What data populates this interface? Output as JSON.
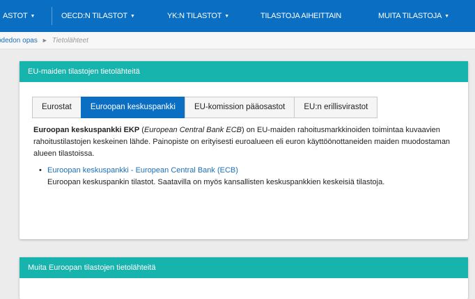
{
  "nav": {
    "items": [
      {
        "label": "ASTOT",
        "has_caret": true
      },
      {
        "label": "OECD:N TILASTOT",
        "has_caret": true
      },
      {
        "label": "YK:N TILASTOT",
        "has_caret": true
      },
      {
        "label": "TILASTOJA AIHEITTAIN",
        "has_caret": false
      },
      {
        "label": "MUITA TILASTOJA",
        "has_caret": true
      }
    ],
    "caret_char": "▼"
  },
  "breadcrumb": {
    "link": "ödedon opas",
    "separator": "►",
    "current": "Tietolähteet"
  },
  "panel1": {
    "title": "EU-maiden tilastojen tietolähteitä",
    "tabs": [
      "Eurostat",
      "Euroopan keskuspankki",
      "EU-komission pääosastot",
      "EU:n erillisvirastot"
    ],
    "active_tab_index": 1,
    "intro_bold": "Euroopan keskuspankki EKP",
    "intro_paren_open": " (",
    "intro_italic": "European Central Bank ECB",
    "intro_rest": ") on EU-maiden rahoitusmarkkinoiden toimintaa kuvaavien rahoitustilastojen keskeinen lähde. Painopiste on erityisesti euroalueen eli euron käyttöönottaneiden maiden muodostaman alueen tilastoissa.",
    "links": [
      {
        "label": "Euroopan keskuspankki - European Central Bank (ECB)",
        "description": "Euroopan keskuspankin tilastot. Saatavilla on myös kansallisten keskuspankkien keskeisiä tilastoja."
      }
    ]
  },
  "panel2": {
    "title": "Muita Euroopan tilastojen tietolähteitä"
  },
  "colors": {
    "nav_bg": "#0a6fc2",
    "panel_header_bg": "#17b3ad",
    "active_tab_bg": "#0a6fc2",
    "link": "#1b6fb8"
  }
}
